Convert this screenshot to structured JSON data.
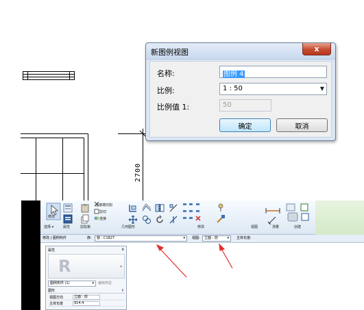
{
  "dialog": {
    "title": "新图例视图",
    "close_label": "x",
    "name_label": "名称:",
    "name_value": "图例 4",
    "scale_label": "比例:",
    "scale_value": "1 : 50",
    "scale_value_label": "比例值 1:",
    "scale_value_value": "50",
    "ok_label": "确定",
    "cancel_label": "取消"
  },
  "drawing": {
    "dimension_text": "2700"
  },
  "ribbon": {
    "modify_label": "修改",
    "select_label": "选择 ▾",
    "properties_label": "属性",
    "clipboard_label": "剪贴板",
    "geometry_label": "几何图形",
    "modify_group_label": "修改",
    "view_label": "视图",
    "measure_label": "测量",
    "create_label": "创建",
    "cut_label": "连接端切割",
    "cut_menu_label": "剪切",
    "join_label": "连接"
  },
  "options_bar": {
    "context_label": "修改 | 图例构件",
    "family_label": "族:",
    "family_value": "窗 : C1827",
    "view_label": "视图:",
    "view_value": "立面 : 前",
    "host_length_label": "主体长度:"
  },
  "properties": {
    "title": "属性",
    "close": "x",
    "preview_letter": "R",
    "type_selector": "图例构件 (1)",
    "edit_type_label": "编辑类型",
    "category_label": "图形",
    "rows": [
      {
        "key": "视图方向",
        "value": "立面 : 前"
      },
      {
        "key": "主体长度",
        "value": "914.4"
      }
    ]
  }
}
